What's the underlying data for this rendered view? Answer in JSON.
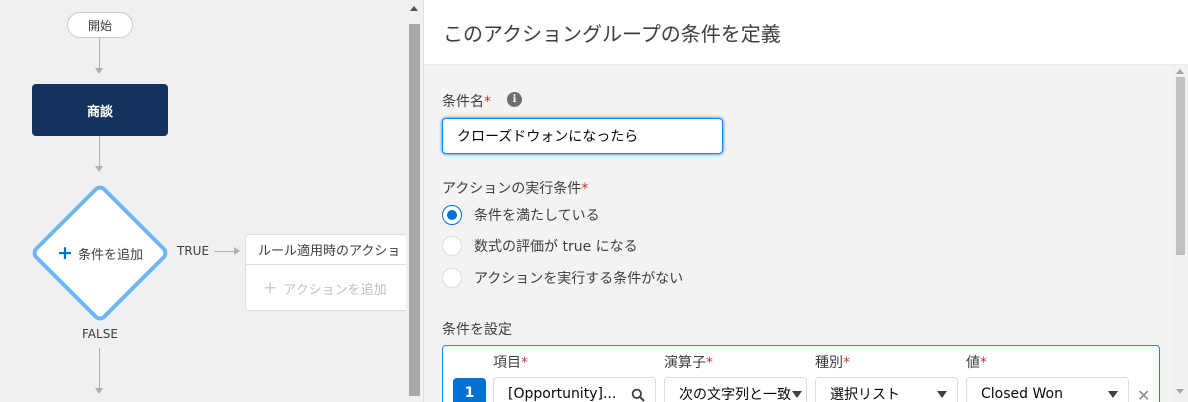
{
  "canvas": {
    "start_label": "開始",
    "object_node_label": "商談",
    "criteria_node_label": "条件を追加",
    "true_label": "TRUE",
    "false_label": "FALSE",
    "action_group_title": "ルール適用時のアクショ",
    "add_action_label": "アクションを追加"
  },
  "panel": {
    "title": "このアクショングループの条件を定義",
    "criteria_name_label": "条件名",
    "required_mark": "*",
    "info_icon": "i",
    "criteria_name_value": "クローズドウォンになったら",
    "execute_label": "アクションの実行条件",
    "radios": [
      {
        "label": "条件を満たしている",
        "selected": true
      },
      {
        "label": "数式の評価が true になる",
        "selected": false
      },
      {
        "label": "アクションを実行する条件がない",
        "selected": false
      }
    ],
    "set_conditions_label": "条件を設定",
    "columns": {
      "field": "項目",
      "operator": "演算子",
      "type": "種別",
      "value": "値"
    },
    "row": {
      "number": "1",
      "field": "[Opportunity]...",
      "operator": "次の文字列と一致",
      "type": "選択リスト",
      "value": "Closed Won",
      "remove": "✕"
    }
  },
  "colors": {
    "accent": "#0070d2",
    "node_dark": "#16325c",
    "diamond_border": "#71b4f5",
    "required": "#c23934"
  },
  "icons": [
    "search-icon",
    "chevron-down-icon",
    "close-icon",
    "info-icon",
    "plus-icon"
  ]
}
